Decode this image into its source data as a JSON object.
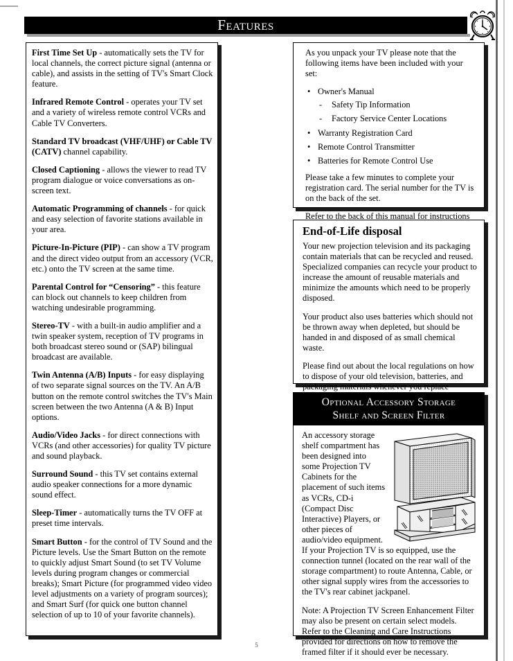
{
  "page": {
    "header_title": "Features",
    "page_number": "5",
    "header_icon": "alarm-clock-icon"
  },
  "left_column": {
    "features": [
      {
        "term": "First Time Set Up",
        "body": " - automatically sets the TV for local channels, the correct picture signal (antenna or cable), and assists in the setting of TV's Smart Clock feature."
      },
      {
        "term": "Infrared Remote Control",
        "body": " - operates your TV set and a variety of wireless remote control VCRs and Cable TV Converters."
      },
      {
        "term": "Standard TV broadcast (VHF/UHF) or Cable TV (CATV)",
        "body": " channel capability."
      },
      {
        "term": "Closed Captioning",
        "body": " - allows the viewer to read TV program dialogue or voice conversations as on-screen text."
      },
      {
        "term": "Automatic Programming of channels",
        "body": " - for quick and easy selection of favorite stations available in your area."
      },
      {
        "term": "Picture-In-Picture (PIP)",
        "body": " - can show a TV program and the direct video output from an accessory (VCR, etc.) onto the TV screen at the same time."
      },
      {
        "term": "Parental Control for “Censoring”",
        "body": " - this feature can block out channels to keep children from watching undesirable programming."
      },
      {
        "term": "Stereo-TV",
        "body": " - with a built-in audio amplifier and a twin speaker system, reception of TV programs in both broadcast stereo sound or (SAP) bilingual broadcast are available."
      },
      {
        "term": "Twin Antenna (A/B) Inputs",
        "body": " - for easy displaying of two separate signal sources on the TV.  An A/B button on the remote control switches the TV's Main screen between the two Antenna (A & B) Input options."
      },
      {
        "term": "Audio/Video Jacks",
        "body": " - for direct connections with VCRs (and other accessories) for quality TV picture and sound playback."
      },
      {
        "term": "Surround Sound",
        "body": " - this TV set contains external audio speaker connections for a more dynamic sound effect."
      },
      {
        "term": "Sleep-Timer",
        "body": " - automatically turns the TV OFF at preset time intervals."
      },
      {
        "term": "Smart Button",
        "body": " - for the control of TV Sound and the Picture levels. Use the Smart Button on the remote to quickly adjust Smart Sound (to set TV Volume levels during program changes or commercial breaks); Smart Picture (for programmed video video level adjustments on a variety of program sources); and Smart Surf (for quick one button channel selection of up to 10 of your favorite channels)."
      }
    ]
  },
  "unpack_box": {
    "intro": "As you unpack your TV please note that the following items have been included with your set:",
    "items": [
      {
        "label": "Owner's Manual",
        "sub_items": [
          "Safety Tip Information",
          "Factory Service Center Locations"
        ]
      },
      {
        "label": "Warranty Registration Card",
        "sub_items": []
      },
      {
        "label": "Remote Control Transmitter",
        "sub_items": []
      },
      {
        "label": "Batteries for Remote Control Use",
        "sub_items": []
      }
    ],
    "paragraphs": [
      "Please take a few minutes to complete your registration card. The serial number for the TV is on the back of the set.",
      "Refer to the back of this manual for instructions on the cleaning and care of the TV."
    ]
  },
  "disposal_box": {
    "heading": "End-of-Life disposal",
    "paragraphs": [
      "Your new projection television and its packaging contain materials that can be recycled and reused. Specialized companies can recycle your product to increase the amount of reusable materials and minimize the amounts which need to be properly disposed.",
      "Your product also uses batteries which should not be thrown away when depleted, but should be handed in and disposed of as small chemical waste.",
      "Please find out about the local regulations on how to dispose of your old television, batteries, and packaging materials whenever you replace existing equipment."
    ]
  },
  "storage_box": {
    "heading_line1": "Optional Accessory Storage",
    "heading_line2": "Shelf and Screen Filter",
    "figure_name": "projection-tv-with-storage-shelf-illustration",
    "paragraphs": [
      "An accessory storage shelf compartment has been designed into some Projection TV Cabinets for the placement of such items as VCRs, CD-i (Compact Disc Interactive) Players, or other pieces of audio/video equipment. If your Projection TV is so equipped, use the connection tunnel (located on the rear wall of the storage compartment) to route Antenna, Cable, or other signal supply wires from the accessories to the TV's rear cabinet jackpanel.",
      "Note: A Projection TV Screen Enhancement Filter may also be present on certain select models. Refer to the Cleaning and Care Instructions provided for directions on how to remove the framed filter if it should ever be necessary."
    ]
  }
}
